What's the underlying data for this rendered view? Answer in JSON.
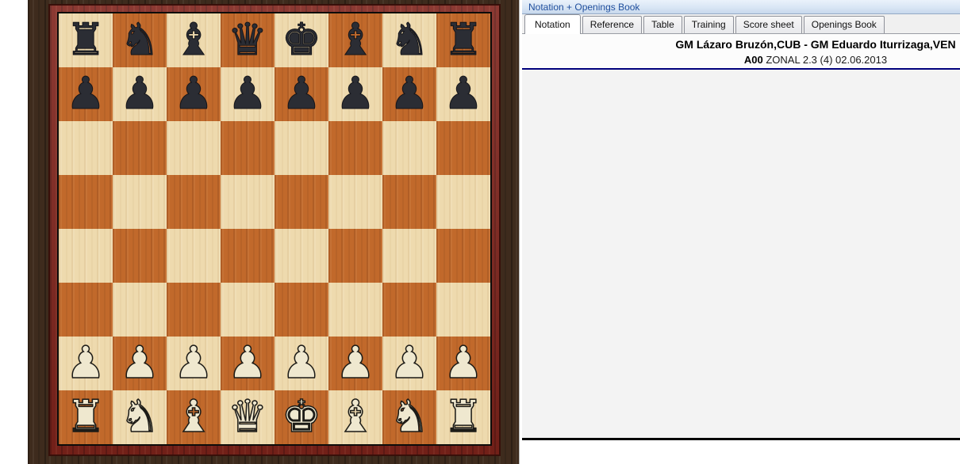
{
  "pane_titlebar": {
    "title": "Notation + Openings Book"
  },
  "tabs": [
    {
      "label": "Notation",
      "active": true
    },
    {
      "label": "Reference",
      "active": false
    },
    {
      "label": "Table",
      "active": false
    },
    {
      "label": "Training",
      "active": false
    },
    {
      "label": "Score sheet",
      "active": false
    },
    {
      "label": "Openings Book",
      "active": false
    }
  ],
  "game_header": {
    "players": "GM Lázaro Bruzón,CUB - GM Eduardo Iturrizaga,VEN",
    "eco": "A00",
    "event_line": " ZONAL 2.3 (4) 02.06.2013"
  },
  "notation": {
    "moves": ""
  },
  "board": {
    "rows": [
      "rnbqkbnr",
      "pppppppp",
      "........",
      "........",
      "........",
      "........",
      "PPPPPPPP",
      "RNBQKBNR"
    ],
    "glyphs": {
      "k": "♚",
      "q": "♛",
      "r": "♜",
      "b": "♝",
      "n": "♞",
      "p": "♟"
    },
    "piece_names": {
      "k": "king",
      "q": "queen",
      "r": "rook",
      "b": "bishop",
      "n": "knight",
      "p": "pawn"
    },
    "colors": {
      "light_square": "#eedaae",
      "dark_square": "#c1692b",
      "frame": "#7e231b",
      "wood_background": "#3e2b1d",
      "white_piece": "#efe8cf",
      "black_piece": "#2b2d34",
      "header_rule": "#00007c",
      "titlebar_text": "#1f4e9d"
    }
  }
}
